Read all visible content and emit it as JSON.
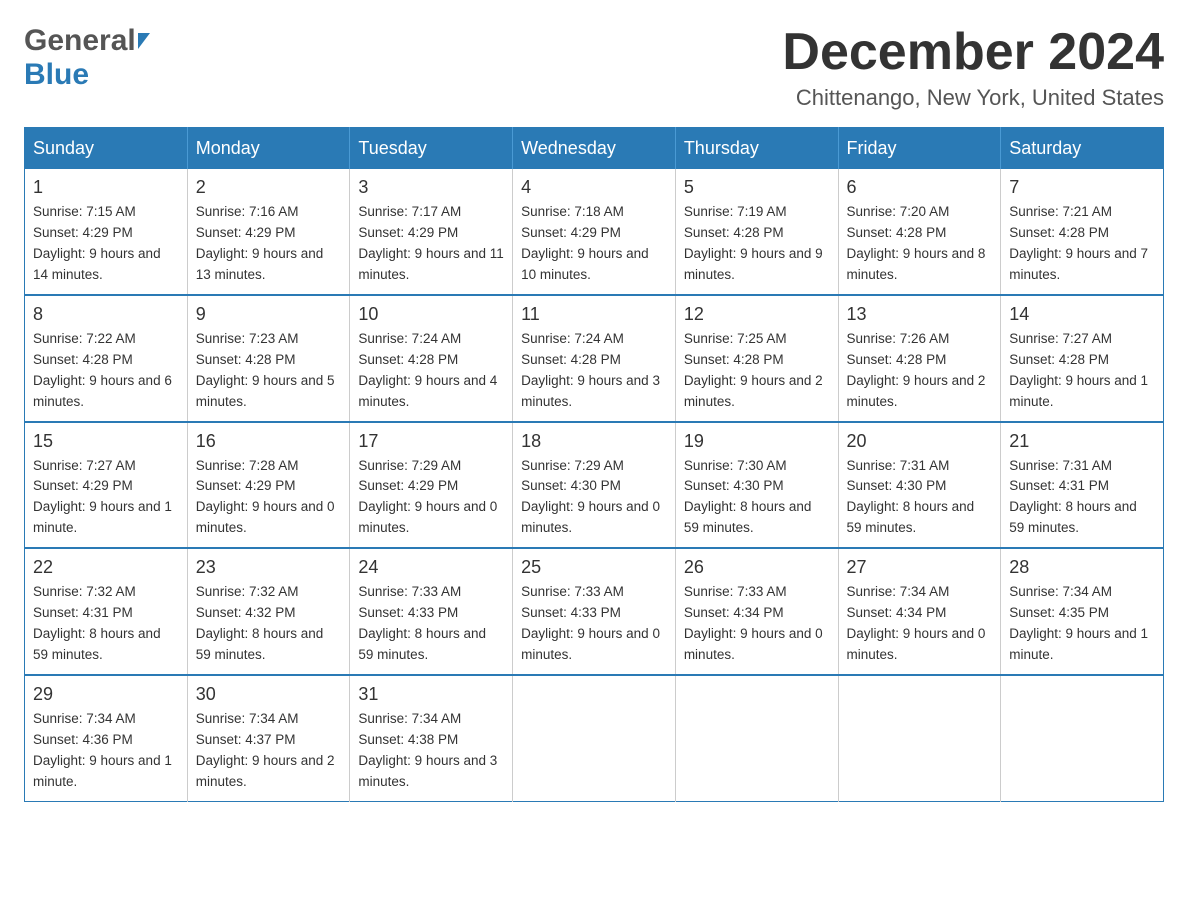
{
  "header": {
    "logo_general": "General",
    "logo_blue": "Blue",
    "month_year": "December 2024",
    "location": "Chittenango, New York, United States"
  },
  "weekdays": [
    "Sunday",
    "Monday",
    "Tuesday",
    "Wednesday",
    "Thursday",
    "Friday",
    "Saturday"
  ],
  "weeks": [
    [
      {
        "day": "1",
        "sunrise": "7:15 AM",
        "sunset": "4:29 PM",
        "daylight": "9 hours and 14 minutes."
      },
      {
        "day": "2",
        "sunrise": "7:16 AM",
        "sunset": "4:29 PM",
        "daylight": "9 hours and 13 minutes."
      },
      {
        "day": "3",
        "sunrise": "7:17 AM",
        "sunset": "4:29 PM",
        "daylight": "9 hours and 11 minutes."
      },
      {
        "day": "4",
        "sunrise": "7:18 AM",
        "sunset": "4:29 PM",
        "daylight": "9 hours and 10 minutes."
      },
      {
        "day": "5",
        "sunrise": "7:19 AM",
        "sunset": "4:28 PM",
        "daylight": "9 hours and 9 minutes."
      },
      {
        "day": "6",
        "sunrise": "7:20 AM",
        "sunset": "4:28 PM",
        "daylight": "9 hours and 8 minutes."
      },
      {
        "day": "7",
        "sunrise": "7:21 AM",
        "sunset": "4:28 PM",
        "daylight": "9 hours and 7 minutes."
      }
    ],
    [
      {
        "day": "8",
        "sunrise": "7:22 AM",
        "sunset": "4:28 PM",
        "daylight": "9 hours and 6 minutes."
      },
      {
        "day": "9",
        "sunrise": "7:23 AM",
        "sunset": "4:28 PM",
        "daylight": "9 hours and 5 minutes."
      },
      {
        "day": "10",
        "sunrise": "7:24 AM",
        "sunset": "4:28 PM",
        "daylight": "9 hours and 4 minutes."
      },
      {
        "day": "11",
        "sunrise": "7:24 AM",
        "sunset": "4:28 PM",
        "daylight": "9 hours and 3 minutes."
      },
      {
        "day": "12",
        "sunrise": "7:25 AM",
        "sunset": "4:28 PM",
        "daylight": "9 hours and 2 minutes."
      },
      {
        "day": "13",
        "sunrise": "7:26 AM",
        "sunset": "4:28 PM",
        "daylight": "9 hours and 2 minutes."
      },
      {
        "day": "14",
        "sunrise": "7:27 AM",
        "sunset": "4:28 PM",
        "daylight": "9 hours and 1 minute."
      }
    ],
    [
      {
        "day": "15",
        "sunrise": "7:27 AM",
        "sunset": "4:29 PM",
        "daylight": "9 hours and 1 minute."
      },
      {
        "day": "16",
        "sunrise": "7:28 AM",
        "sunset": "4:29 PM",
        "daylight": "9 hours and 0 minutes."
      },
      {
        "day": "17",
        "sunrise": "7:29 AM",
        "sunset": "4:29 PM",
        "daylight": "9 hours and 0 minutes."
      },
      {
        "day": "18",
        "sunrise": "7:29 AM",
        "sunset": "4:30 PM",
        "daylight": "9 hours and 0 minutes."
      },
      {
        "day": "19",
        "sunrise": "7:30 AM",
        "sunset": "4:30 PM",
        "daylight": "8 hours and 59 minutes."
      },
      {
        "day": "20",
        "sunrise": "7:31 AM",
        "sunset": "4:30 PM",
        "daylight": "8 hours and 59 minutes."
      },
      {
        "day": "21",
        "sunrise": "7:31 AM",
        "sunset": "4:31 PM",
        "daylight": "8 hours and 59 minutes."
      }
    ],
    [
      {
        "day": "22",
        "sunrise": "7:32 AM",
        "sunset": "4:31 PM",
        "daylight": "8 hours and 59 minutes."
      },
      {
        "day": "23",
        "sunrise": "7:32 AM",
        "sunset": "4:32 PM",
        "daylight": "8 hours and 59 minutes."
      },
      {
        "day": "24",
        "sunrise": "7:33 AM",
        "sunset": "4:33 PM",
        "daylight": "8 hours and 59 minutes."
      },
      {
        "day": "25",
        "sunrise": "7:33 AM",
        "sunset": "4:33 PM",
        "daylight": "9 hours and 0 minutes."
      },
      {
        "day": "26",
        "sunrise": "7:33 AM",
        "sunset": "4:34 PM",
        "daylight": "9 hours and 0 minutes."
      },
      {
        "day": "27",
        "sunrise": "7:34 AM",
        "sunset": "4:34 PM",
        "daylight": "9 hours and 0 minutes."
      },
      {
        "day": "28",
        "sunrise": "7:34 AM",
        "sunset": "4:35 PM",
        "daylight": "9 hours and 1 minute."
      }
    ],
    [
      {
        "day": "29",
        "sunrise": "7:34 AM",
        "sunset": "4:36 PM",
        "daylight": "9 hours and 1 minute."
      },
      {
        "day": "30",
        "sunrise": "7:34 AM",
        "sunset": "4:37 PM",
        "daylight": "9 hours and 2 minutes."
      },
      {
        "day": "31",
        "sunrise": "7:34 AM",
        "sunset": "4:38 PM",
        "daylight": "9 hours and 3 minutes."
      },
      null,
      null,
      null,
      null
    ]
  ],
  "labels": {
    "sunrise": "Sunrise:",
    "sunset": "Sunset:",
    "daylight": "Daylight:"
  }
}
